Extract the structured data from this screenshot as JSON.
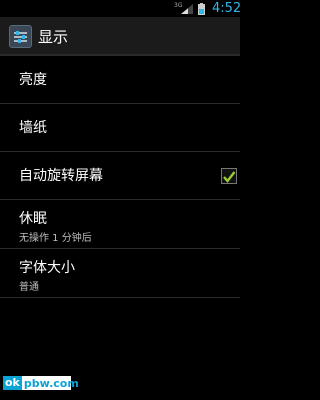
{
  "status_bar": {
    "network": "3G",
    "time": "4:52"
  },
  "action_bar": {
    "title": "显示"
  },
  "settings": [
    {
      "label": "亮度"
    },
    {
      "label": "墙纸"
    },
    {
      "label": "自动旋转屏幕",
      "checked": true
    },
    {
      "label": "休眠",
      "summary": "无操作 1 分钟后"
    },
    {
      "label": "字体大小",
      "summary": "普通"
    }
  ],
  "watermark": {
    "prefix": "ok",
    "rest": "pbw.com"
  },
  "colors": {
    "accent": "#33b5e5",
    "checkmark": "#9acd32"
  }
}
